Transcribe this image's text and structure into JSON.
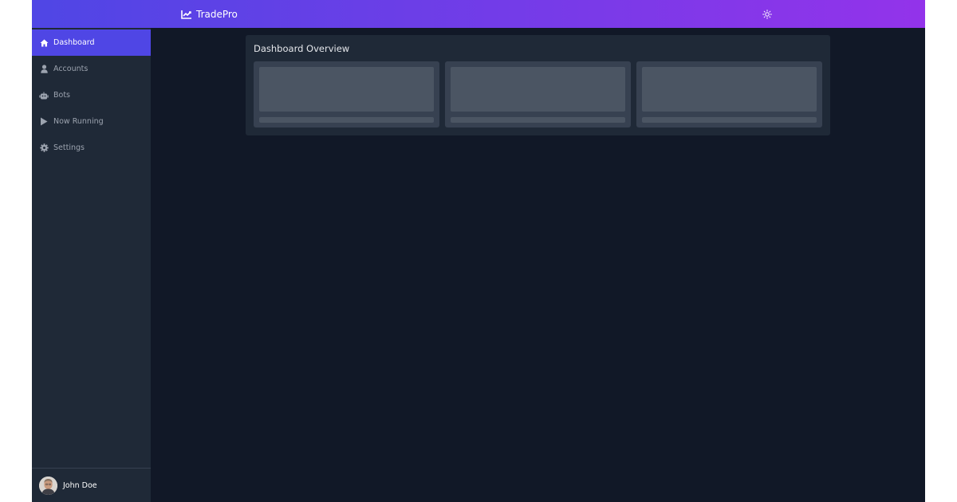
{
  "header": {
    "brand_name": "TradePro",
    "brand_icon": "chart-line-icon",
    "theme_toggle_icon": "sun-icon"
  },
  "sidebar": {
    "items": [
      {
        "label": "Dashboard",
        "icon": "home-icon",
        "active": true
      },
      {
        "label": "Accounts",
        "icon": "user-icon",
        "active": false
      },
      {
        "label": "Bots",
        "icon": "robot-icon",
        "active": false
      },
      {
        "label": "Now Running",
        "icon": "play-icon",
        "active": false
      },
      {
        "label": "Settings",
        "icon": "gear-icon",
        "active": false
      }
    ],
    "user": {
      "name": "John Doe",
      "avatar_icon": "avatar"
    }
  },
  "main": {
    "panel_title": "Dashboard Overview",
    "cards": [
      {
        "state": "loading"
      },
      {
        "state": "loading"
      },
      {
        "state": "loading"
      }
    ]
  },
  "colors": {
    "header_gradient_start": "#4f46e5",
    "header_gradient_end": "#9333ea",
    "background": "#111827",
    "sidebar": "#1f2937",
    "active_item": "#4f46e5",
    "card": "#374151",
    "skeleton": "#4b5563"
  }
}
